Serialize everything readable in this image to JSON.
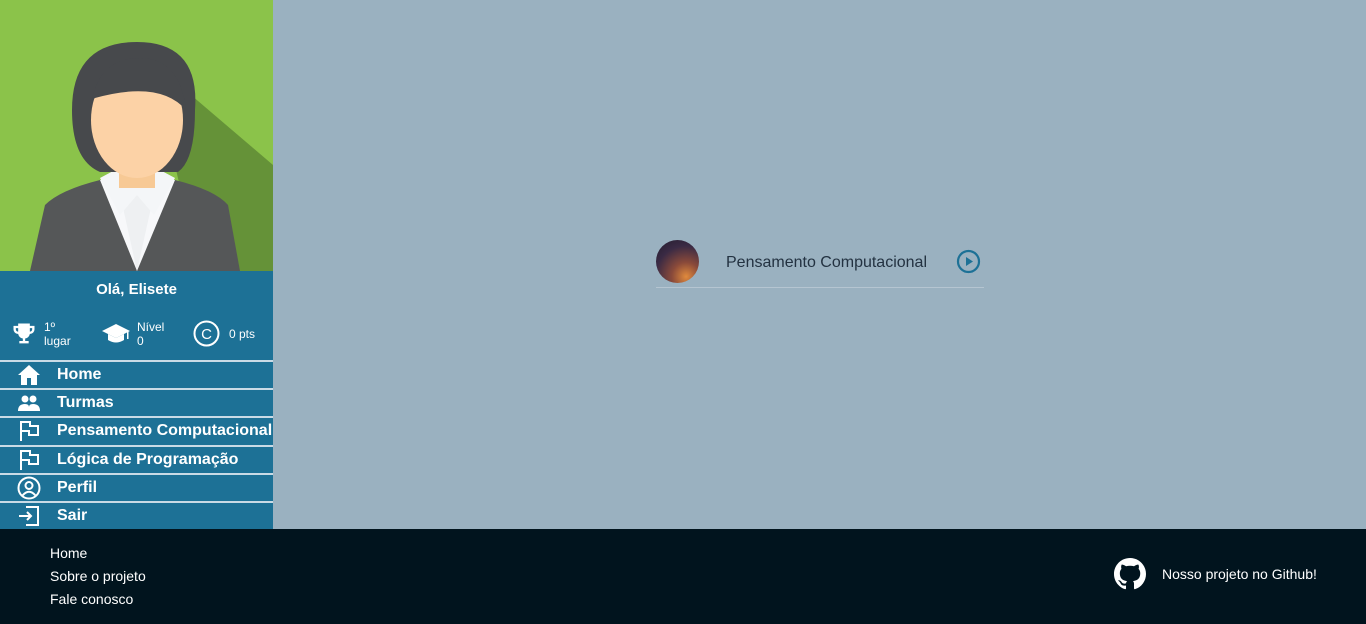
{
  "sidebar": {
    "greeting": "Olá, Elisete",
    "stats": [
      {
        "icon": "trophy-icon",
        "line1": "1º",
        "line2": "lugar"
      },
      {
        "icon": "graduation-cap-icon",
        "line1": "Nível",
        "line2": "0"
      },
      {
        "icon": "coin-icon",
        "line1": "0 pts",
        "line2": ""
      }
    ],
    "menu": [
      {
        "label": "Home",
        "icon": "home-icon"
      },
      {
        "label": "Turmas",
        "icon": "users-icon"
      },
      {
        "label": "Pensamento Computacional",
        "icon": "flag-icon"
      },
      {
        "label": "Lógica de Programação",
        "icon": "flag-icon"
      },
      {
        "label": "Perfil",
        "icon": "user-circle-icon"
      },
      {
        "label": "Sair",
        "icon": "logout-icon"
      }
    ]
  },
  "main": {
    "course": {
      "title": "Pensamento Computacional",
      "icon": "play-circle-icon"
    }
  },
  "footer": {
    "links": [
      "Home",
      "Sobre o projeto",
      "Fale conosco"
    ],
    "github_label": "Nosso projeto no Github!"
  },
  "colors": {
    "sidebar": "#1d7196",
    "main_bg": "#9ab1c0",
    "footer": "#01141e",
    "avatar_bg": "#8bc34a"
  }
}
